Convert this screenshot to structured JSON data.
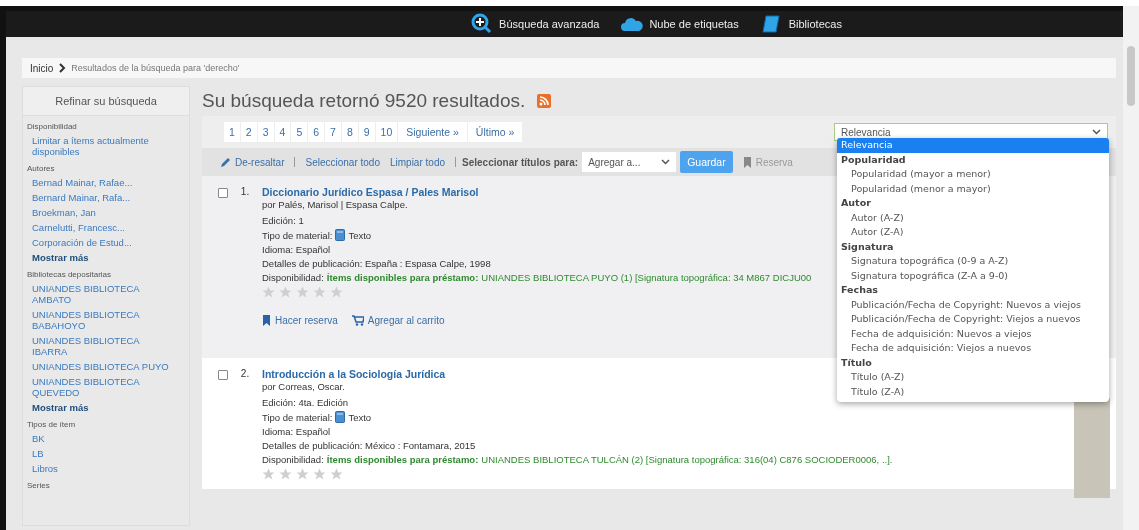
{
  "nav": [
    {
      "label": "Búsqueda avanzada"
    },
    {
      "label": "Nube de etiquetas"
    },
    {
      "label": "Bibliotecas"
    }
  ],
  "breadcrumb": [
    {
      "label": "Inicio"
    },
    {
      "label": "Resultados de la búsqueda para 'derecho'"
    }
  ],
  "sidebar": {
    "title": "Refinar su búsqueda",
    "sections": [
      {
        "heading": "Disponibilidad",
        "items": [
          {
            "label": "Limitar a ítems actualmente disponibles",
            "kind": "link"
          }
        ]
      },
      {
        "heading": "Autores",
        "items": [
          {
            "label": "Bernad Mainar, Rafae...",
            "kind": "link"
          },
          {
            "label": "Bernard Mainar, Rafa...",
            "kind": "link"
          },
          {
            "label": "Broekman, Jan",
            "kind": "link"
          },
          {
            "label": "Carnelutti, Francesc...",
            "kind": "link"
          },
          {
            "label": "Corporación de Estud...",
            "kind": "link"
          },
          {
            "label": "Mostrar más",
            "kind": "more"
          }
        ]
      },
      {
        "heading": "Bibliotecas depositarias",
        "items": [
          {
            "label": "UNIANDES BIBLIOTECA AMBATO",
            "kind": "link"
          },
          {
            "label": "UNIANDES BIBLIOTECA BABAHOYO",
            "kind": "link"
          },
          {
            "label": "UNIANDES BIBLIOTECA IBARRA",
            "kind": "link"
          },
          {
            "label": "UNIANDES BIBLIOTECA PUYO",
            "kind": "link"
          },
          {
            "label": "UNIANDES BIBLIOTECA QUEVEDO",
            "kind": "link"
          },
          {
            "label": "Mostrar más",
            "kind": "more"
          }
        ]
      },
      {
        "heading": "Tipos de ítem",
        "items": [
          {
            "label": "BK",
            "kind": "link"
          },
          {
            "label": "LB",
            "kind": "link"
          },
          {
            "label": "Libros",
            "kind": "link"
          }
        ]
      },
      {
        "heading": "Series"
      }
    ]
  },
  "heading": "Su búsqueda retornó 9520 resultados.",
  "pagination": [
    {
      "label": "1"
    },
    {
      "label": "2"
    },
    {
      "label": "3"
    },
    {
      "label": "4"
    },
    {
      "label": "5"
    },
    {
      "label": "6"
    },
    {
      "label": "7"
    },
    {
      "label": "8"
    },
    {
      "label": "9"
    },
    {
      "label": "10"
    },
    {
      "label": "Siguiente »"
    },
    {
      "label": "Último »"
    }
  ],
  "sort": {
    "value": "Relevancia",
    "open": true,
    "options": [
      {
        "label": "Relevancia",
        "kind": "option",
        "selected": true
      },
      {
        "label": "Popularidad",
        "kind": "group"
      },
      {
        "label": "Popularidad (mayor a menor)",
        "kind": "option",
        "selected": false
      },
      {
        "label": "Popularidad (menor a mayor)",
        "kind": "option",
        "selected": false
      },
      {
        "label": "Autor",
        "kind": "group"
      },
      {
        "label": "Autor (A-Z)",
        "kind": "option",
        "selected": false
      },
      {
        "label": "Autor (Z-A)",
        "kind": "option",
        "selected": false
      },
      {
        "label": "Signatura",
        "kind": "group"
      },
      {
        "label": "Signatura topográfica (0-9 a A-Z)",
        "kind": "option",
        "selected": false
      },
      {
        "label": "Signatura topográfica (Z-A a 9-0)",
        "kind": "option",
        "selected": false
      },
      {
        "label": "Fechas",
        "kind": "group"
      },
      {
        "label": "Publicación/Fecha de Copyright: Nuevos a viejos",
        "kind": "option",
        "selected": false
      },
      {
        "label": "Publicación/Fecha de Copyright: Viejos a nuevos",
        "kind": "option",
        "selected": false
      },
      {
        "label": "Fecha de adquisición: Nuevos a viejos",
        "kind": "option",
        "selected": false
      },
      {
        "label": "Fecha de adquisición: Viejos a nuevos",
        "kind": "option",
        "selected": false
      },
      {
        "label": "Título",
        "kind": "group"
      },
      {
        "label": "Título (A-Z)",
        "kind": "option",
        "selected": false
      },
      {
        "label": "Título (Z-A)",
        "kind": "option",
        "selected": false
      }
    ]
  },
  "toolbar": {
    "unhighlight": "De-resaltar",
    "select_all": "Seleccionar todo",
    "clear_all": "Limpiar todo",
    "select_label": "Seleccionar títulos para:",
    "list_select": "Agregar a...",
    "save": "Guardar",
    "hold": "Reserva"
  },
  "results": [
    {
      "number": "1.",
      "checked": false,
      "highlighted": true,
      "title": "Diccionario Jurídico Espasa / Pales Marisol",
      "author": "por Palés, Marisol | Espasa Calpe.",
      "edition": "Edición: 1",
      "material_label": "Tipo de material:",
      "material": "Texto",
      "language": "Idioma: Español",
      "publication": "Detalles de publicación: España : Espasa Calpe, 1998",
      "availability_label": "Disponibilidad:",
      "availability_status": "Ítems disponibles para préstamo:",
      "availability_detail": "UNIANDES BIBLIOTECA PUYO (1) [Signatura topográfica: 34 M867 DICJU00",
      "stars": 0,
      "actions": [
        {
          "label": "Hacer reserva",
          "kind": "hold"
        },
        {
          "label": "Agregar al carrito",
          "kind": "cart"
        }
      ],
      "cover": false
    },
    {
      "number": "2.",
      "checked": false,
      "highlighted": false,
      "title": "Introducción a la Sociología Jurídica",
      "author": "por Correas, Oscar.",
      "edition": "Edición: 4ta. Edición",
      "material_label": "Tipo de material:",
      "material": "Texto",
      "language": "Idioma: Español",
      "publication": "Detalles de publicación: México : Fontamara, 2015",
      "availability_label": "Disponibilidad:",
      "availability_status": "Ítems disponibles para préstamo:",
      "availability_detail": "UNIANDES BIBLIOTECA TULCÁN (2) [Signatura topográfica: 316(04) C876 SOCIODER0006, ..].",
      "stars": 0,
      "cover": true
    }
  ]
}
